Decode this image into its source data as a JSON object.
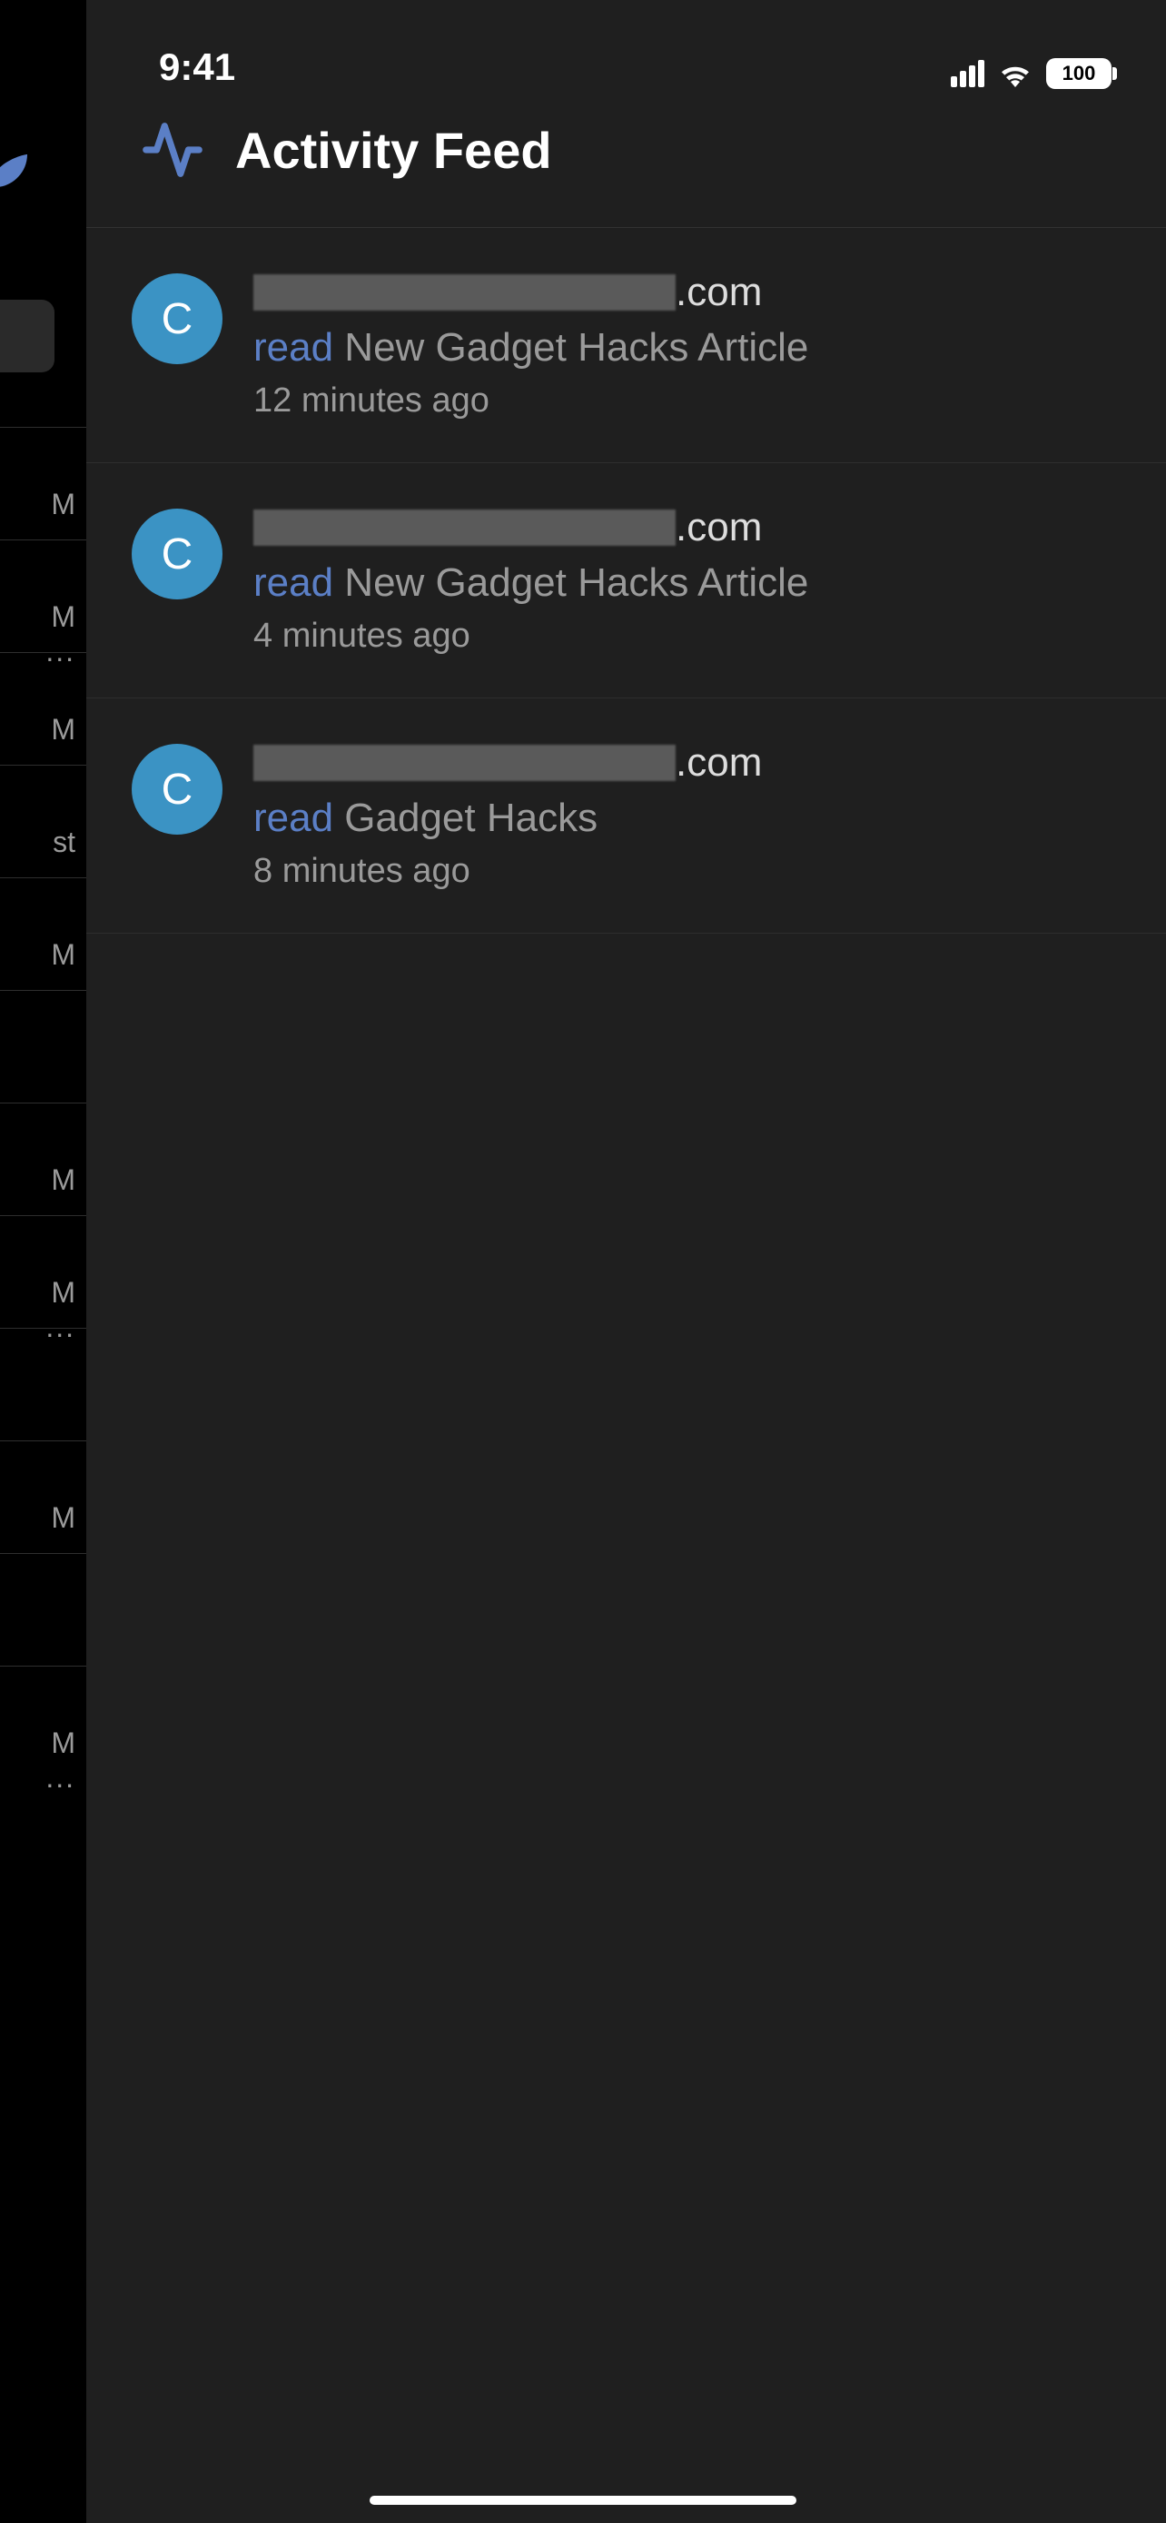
{
  "status": {
    "time": "9:41",
    "battery": "100"
  },
  "header": {
    "title": "Activity Feed"
  },
  "peek": {
    "rows": [
      {
        "text": "M",
        "dots": ""
      },
      {
        "text": "M",
        "dots": "..."
      },
      {
        "text": "M",
        "dots": ""
      },
      {
        "text": "st",
        "dots": ""
      },
      {
        "text": "M",
        "dots": ""
      },
      {
        "text": "",
        "dots": ""
      },
      {
        "text": "M",
        "dots": ""
      },
      {
        "text": "M",
        "dots": "..."
      },
      {
        "text": "",
        "dots": ""
      },
      {
        "text": "M",
        "dots": ""
      },
      {
        "text": "",
        "dots": ""
      },
      {
        "text": "M",
        "dots": "..."
      }
    ]
  },
  "feed": [
    {
      "avatarInitial": "C",
      "domainSuffix": ".com",
      "redactedWidth": 465,
      "verb": "read",
      "object": "New Gadget Hacks Article",
      "time": "12 minutes ago"
    },
    {
      "avatarInitial": "C",
      "domainSuffix": ".com",
      "redactedWidth": 465,
      "verb": "read",
      "object": "New Gadget Hacks Article",
      "time": "4 minutes ago"
    },
    {
      "avatarInitial": "C",
      "domainSuffix": ".com",
      "redactedWidth": 465,
      "verb": "read",
      "object": "Gadget Hacks",
      "time": "8 minutes ago"
    }
  ]
}
